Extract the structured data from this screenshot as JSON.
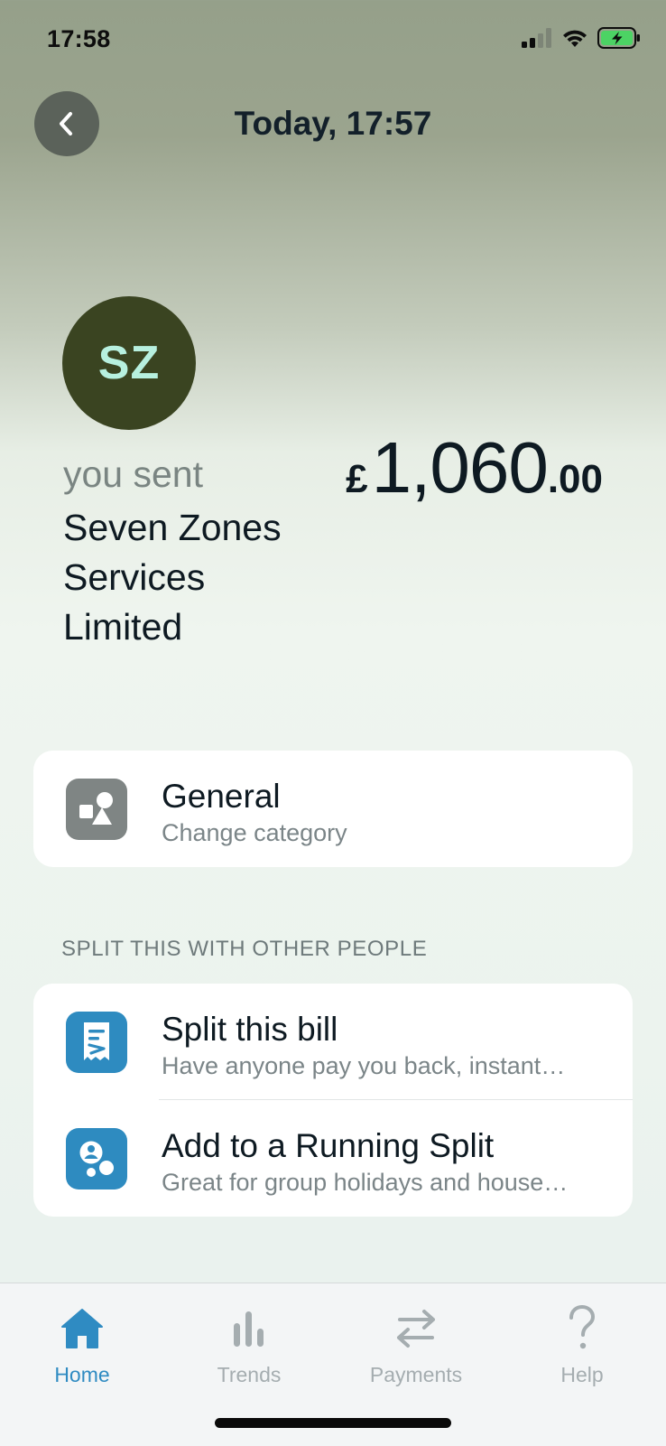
{
  "status_bar": {
    "time": "17:58"
  },
  "header": {
    "title": "Today, 17:57"
  },
  "transaction": {
    "avatar_initials": "SZ",
    "direction": "you sent",
    "merchant": "Seven Zones Services Limited",
    "amount": {
      "currency": "£",
      "major": "1,060",
      "minor": ".00"
    }
  },
  "category": {
    "title": "General",
    "subtitle": "Change category"
  },
  "split_section": {
    "label": "SPLIT THIS WITH OTHER PEOPLE",
    "items": [
      {
        "title": "Split this bill",
        "subtitle": "Have anyone pay you back, instant…"
      },
      {
        "title": "Add to a Running Split",
        "subtitle": "Great for group holidays and house…"
      }
    ]
  },
  "tabs": [
    {
      "label": "Home",
      "icon": "home-icon",
      "active": true
    },
    {
      "label": "Trends",
      "icon": "trends-icon",
      "active": false
    },
    {
      "label": "Payments",
      "icon": "payments-icon",
      "active": false
    },
    {
      "label": "Help",
      "icon": "help-icon",
      "active": false
    }
  ],
  "colors": {
    "accent": "#2f8bc2",
    "avatar_bg": "#3a4421",
    "avatar_text": "#b7f0df",
    "split_icon_bg": "#2e8bc0",
    "category_icon_bg": "#7f8584"
  }
}
